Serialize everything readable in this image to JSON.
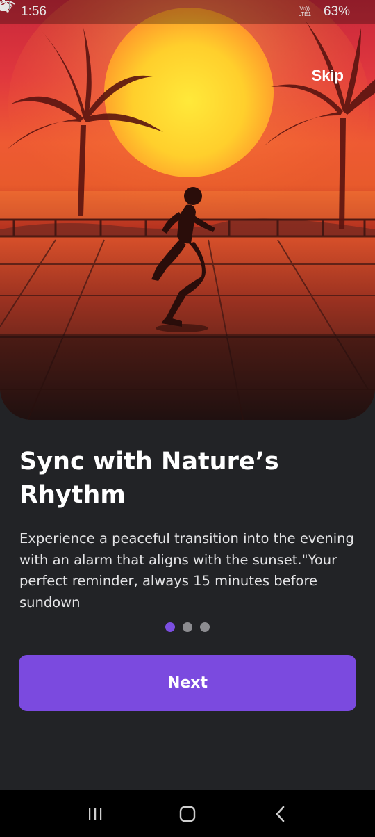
{
  "status_bar": {
    "time": "1:56",
    "battery": "63%",
    "network_badge_top": "Vo))",
    "network_badge_bottom": "LTE1",
    "icons": [
      "mute-icon",
      "wifi-icon",
      "signal-icon",
      "signal-icon",
      "battery-icon"
    ]
  },
  "onboarding": {
    "skip_label": "Skip",
    "title": "Sync with Nature’s Rhythm",
    "description": "Experience a peaceful transition into the evening with an alarm that aligns with the sunset.\"Your perfect reminder, always 15 minutes before sundown",
    "page_indicator": {
      "total": 3,
      "current": 1
    },
    "next_label": "Next"
  },
  "nav_bar": {
    "icons": [
      "recent-apps-icon",
      "home-icon",
      "back-icon"
    ]
  },
  "colors": {
    "background": "#222326",
    "accent": "#7b4adf",
    "dot_active": "#7b4ee0",
    "dot_inactive": "#8c8c90",
    "text_primary": "#ffffff",
    "text_secondary": "#e4e4e6"
  }
}
